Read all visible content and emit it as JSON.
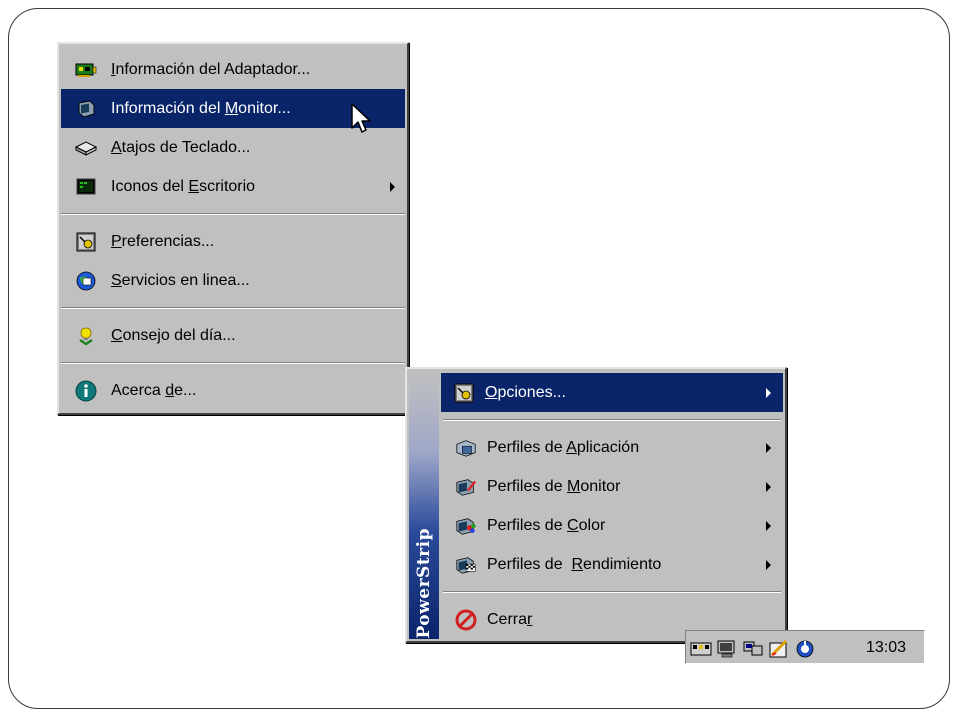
{
  "main_menu": {
    "items": [
      {
        "pre": "",
        "key": "I",
        "post": "nformación del Adaptador...",
        "icon": "adapter-card-icon"
      },
      {
        "pre": "Información del ",
        "key": "M",
        "post": "onitor...",
        "icon": "monitor-icon",
        "selected": true
      },
      {
        "pre": "",
        "key": "A",
        "post": "tajos de Teclado...",
        "icon": "keyboard-icon"
      },
      {
        "pre": "Iconos del ",
        "key": "E",
        "post": "scritorio",
        "icon": "desktop-icon",
        "submenu": true
      },
      {
        "pre": "",
        "key": "P",
        "post": "referencias...",
        "icon": "preferences-icon"
      },
      {
        "pre": "",
        "key": "S",
        "post": "ervicios en linea...",
        "icon": "online-services-icon"
      },
      {
        "pre": "",
        "key": "C",
        "post": "onsejo del día...",
        "icon": "tip-icon"
      },
      {
        "pre": "Acerca ",
        "key": "d",
        "post": "e...",
        "icon": "info-icon"
      }
    ]
  },
  "sub_menu": {
    "banner": "PowerStrip",
    "items": [
      {
        "pre": "",
        "key": "O",
        "post": "pciones...",
        "icon": "options-icon",
        "selected": true,
        "submenu": true
      },
      {
        "pre": "Perfiles de ",
        "key": "A",
        "post": "plicación",
        "icon": "app-profile-icon",
        "submenu": true
      },
      {
        "pre": "Perfiles de ",
        "key": "M",
        "post": "onitor",
        "icon": "monitor-profile-icon",
        "submenu": true
      },
      {
        "pre": "Perfiles de ",
        "key": "C",
        "post": "olor",
        "icon": "color-profile-icon",
        "submenu": true
      },
      {
        "pre": "Perfiles de  ",
        "key": "R",
        "post": "endimiento",
        "icon": "performance-profile-icon",
        "submenu": true
      },
      {
        "pre": "Cerra",
        "key": "r",
        "post": "",
        "icon": "close-icon"
      }
    ]
  },
  "tray": {
    "clock": "13:03",
    "icons": [
      "network-icon",
      "display-icon",
      "monitor-tray-icon",
      "pencil-icon",
      "powerstrip-tray-icon"
    ]
  }
}
